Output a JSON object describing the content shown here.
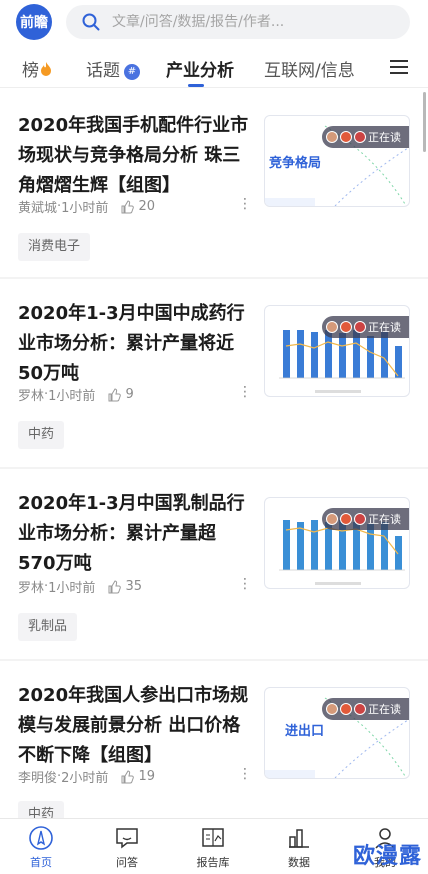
{
  "header": {
    "logo_text": "前瞻",
    "search_placeholder": "文章/问答/数据/报告/作者..."
  },
  "tabs": [
    {
      "label": "榜",
      "has_hot_icon": true
    },
    {
      "label": "话题",
      "has_badge": true,
      "badge": "#"
    },
    {
      "label": "产业分析",
      "active": true
    },
    {
      "label": "互联网/信息"
    }
  ],
  "articles": [
    {
      "title": "2020年我国手机配件行业市场现状与竞争格局分析 珠三角熠熠生辉【组图】",
      "author": "黄斌城",
      "time": "1小时前",
      "likes": "20",
      "tag": "消费电子",
      "thumb_text": "竞争格局",
      "reading_label": "正在读"
    },
    {
      "title": "2020年1-3月中国中成药行业市场分析：累计产量将近50万吨",
      "author": "罗林",
      "time": "1小时前",
      "likes": "9",
      "tag": "中药",
      "reading_label": "正在读"
    },
    {
      "title": "2020年1-3月中国乳制品行业市场分析：累计产量超570万吨",
      "author": "罗林",
      "time": "1小时前",
      "likes": "35",
      "tag": "乳制品",
      "reading_label": "正在读"
    },
    {
      "title": "2020年我国人参出口市场规模与发展前景分析 出口价格不断下降【组图】",
      "author": "李明俊",
      "time": "2小时前",
      "likes": "19",
      "tag": "中药",
      "thumb_text": "进出口",
      "reading_label": "正在读"
    }
  ],
  "bottom_nav": [
    {
      "label": "首页",
      "active": true
    },
    {
      "label": "问答"
    },
    {
      "label": "报告库"
    },
    {
      "label": "数据"
    },
    {
      "label": "我的"
    }
  ],
  "watermark": "欧漫露",
  "colors": {
    "accent": "#2f62d8",
    "muted": "#8a8a8a",
    "tag_bg": "#f3f3f5"
  }
}
